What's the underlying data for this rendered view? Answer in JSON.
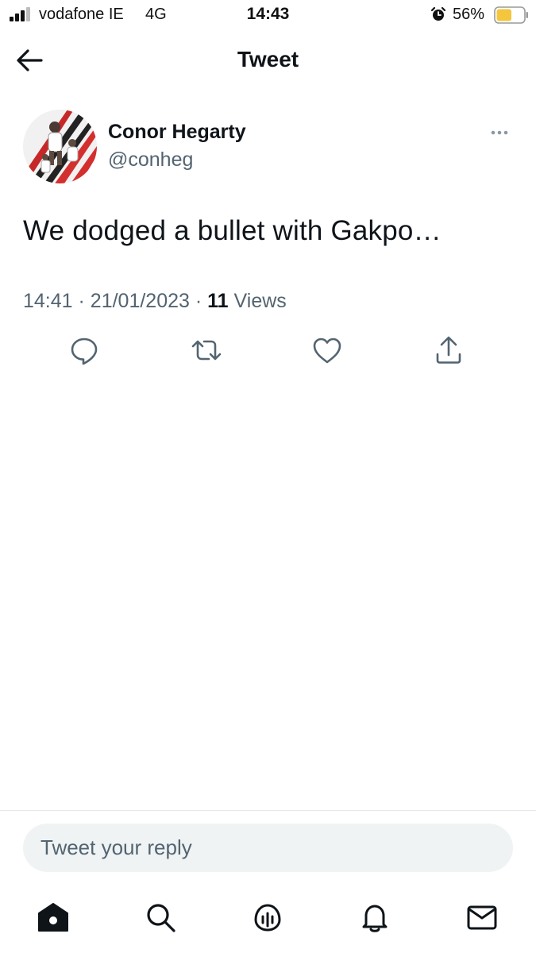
{
  "status_bar": {
    "carrier": "vodafone IE",
    "network": "4G",
    "time": "14:43",
    "battery_percent": "56%",
    "battery_level": 0.56,
    "battery_color": "#f4c63d",
    "icons": [
      "signal-bars-icon",
      "alarm-icon",
      "battery-icon"
    ]
  },
  "header": {
    "title": "Tweet",
    "back_icon": "arrow-left-icon"
  },
  "tweet": {
    "author": {
      "display_name": "Conor Hegarty",
      "handle": "@conheg"
    },
    "text": "We dodged a bullet with Gakpo…",
    "meta": {
      "time": "14:41",
      "separator": "·",
      "date": "21/01/2023",
      "views_count": "11",
      "views_label": "Views"
    },
    "actions": [
      "reply-icon",
      "retweet-icon",
      "like-icon",
      "share-icon"
    ],
    "more_icon": "more-horizontal-icon"
  },
  "reply": {
    "placeholder": "Tweet your reply",
    "value": ""
  },
  "tab_bar": {
    "items": [
      "home-icon",
      "search-icon",
      "spaces-icon",
      "notifications-icon",
      "messages-icon"
    ]
  },
  "colors": {
    "text_primary": "#0f1419",
    "text_secondary": "#536471",
    "input_background": "#eff3f4",
    "divider": "#e4e9ec"
  }
}
